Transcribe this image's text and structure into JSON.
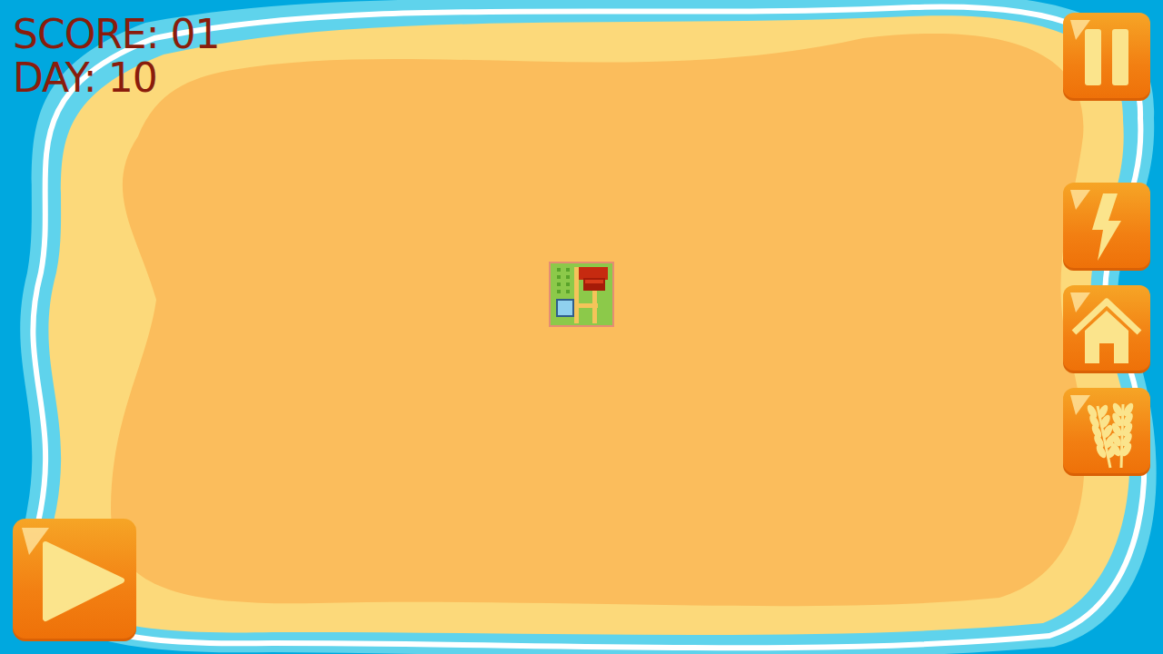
{
  "hud": {
    "score": "SCORE: 01",
    "day": "DAY: 10"
  },
  "top_button": {
    "kind": "pause"
  },
  "side_buttons": [
    {
      "kind": "power"
    },
    {
      "kind": "house"
    },
    {
      "kind": "farm"
    }
  ],
  "play_button": {
    "kind": "play"
  },
  "map": {
    "buildings": [
      {
        "kind": "farm"
      }
    ]
  }
}
